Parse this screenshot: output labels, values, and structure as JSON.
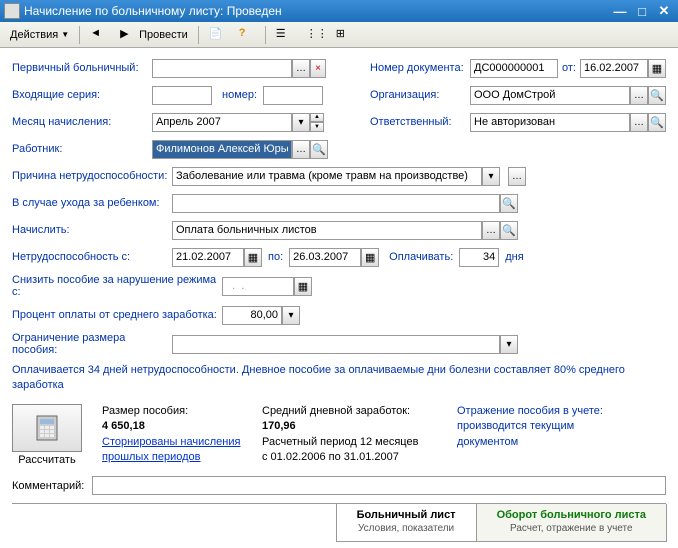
{
  "window": {
    "title": "Начисление по больничному листу: Проведен"
  },
  "toolbar": {
    "actions": "Действия",
    "run": "Провести"
  },
  "left": {
    "primary_label": "Первичный больничный:",
    "primary_value": "",
    "incoming_series_label": "Входящие серия:",
    "incoming_series_value": "",
    "number_label": "номер:",
    "number_value": "",
    "month_label": "Месяц начисления:",
    "month_value": "Апрель 2007",
    "worker_label": "Работник:",
    "worker_value": "Филимонов Алексей Юрьевич"
  },
  "right": {
    "docnum_label": "Номер документа:",
    "docnum_value": "ДС000000001",
    "from_label": "от:",
    "from_value": "16.02.2007",
    "org_label": "Организация:",
    "org_value": "ООО ДомСтрой",
    "resp_label": "Ответственный:",
    "resp_value": "Не авторизован"
  },
  "mid": {
    "reason_label": "Причина нетрудоспособности:",
    "reason_value": "Заболевание или травма (кроме травм на производстве)",
    "child_label": "В случае ухода за ребенком:",
    "child_value": "",
    "accrue_label": "Начислить:",
    "accrue_value": "Оплата больничных листов",
    "disab_from_label": "Нетрудоспособность с:",
    "disab_from_value": "21.02.2007",
    "to_label": "по:",
    "disab_to_value": "26.03.2007",
    "pay_label": "Оплачивать:",
    "pay_days": "34",
    "days_label": "дня",
    "reduce_label": "Снизить пособие за нарушение режима с:",
    "reduce_value": "  .  .",
    "percent_label": "Процент оплаты от среднего заработка:",
    "percent_value": "80,00",
    "limit_label": "Ограничение размера пособия:",
    "limit_value": ""
  },
  "info_text": "Оплачивается 34 дней нетрудоспособности. Дневное пособие за оплачиваемые дни болезни составляет 80% среднего заработка",
  "calc": {
    "button": "Рассчитать",
    "col1_h": "Размер пособия:",
    "col1_v": "4 650,18",
    "col1_link": "Сторнированы начисления прошлых периодов",
    "col2_h": "Средний дневной заработок:",
    "col2_v": "170,96",
    "col2_t1": "Расчетный период 12 месяцев",
    "col2_t2": "с 01.02.2006 по 31.01.2007",
    "col3_h": "Отражение пособия в учете:",
    "col3_t": "производится текущим документом"
  },
  "comment_label": "Комментарий:",
  "comment_value": "",
  "tabs": {
    "t1": "Больничный лист",
    "t1s": "Условия, показатели",
    "t2": "Оборот больничного листа",
    "t2s": "Расчет, отражение в учете"
  }
}
